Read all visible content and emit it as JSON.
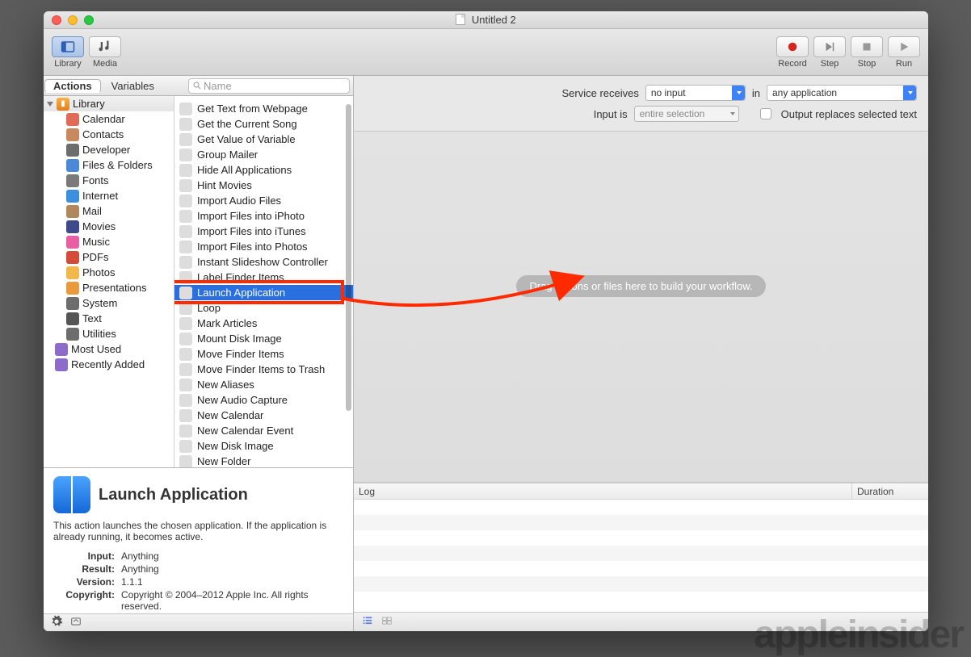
{
  "window": {
    "title": "Untitled 2"
  },
  "toolbar": {
    "library": "Library",
    "media": "Media",
    "record": "Record",
    "step": "Step",
    "stop": "Stop",
    "run": "Run"
  },
  "tabs": {
    "actions": "Actions",
    "variables": "Variables"
  },
  "search": {
    "placeholder": "Name"
  },
  "library_tree": {
    "root": "Library",
    "children": [
      "Calendar",
      "Contacts",
      "Developer",
      "Files & Folders",
      "Fonts",
      "Internet",
      "Mail",
      "Movies",
      "Music",
      "PDFs",
      "Photos",
      "Presentations",
      "System",
      "Text",
      "Utilities"
    ],
    "extra": [
      "Most Used",
      "Recently Added"
    ]
  },
  "actions": [
    "Get Text from Webpage",
    "Get the Current Song",
    "Get Value of Variable",
    "Group Mailer",
    "Hide All Applications",
    "Hint Movies",
    "Import Audio Files",
    "Import Files into iPhoto",
    "Import Files into iTunes",
    "Import Files into Photos",
    "Instant Slideshow Controller",
    "Label Finder Items",
    "Launch Application",
    "Loop",
    "Mark Articles",
    "Mount Disk Image",
    "Move Finder Items",
    "Move Finder Items to Trash",
    "New Aliases",
    "New Audio Capture",
    "New Calendar",
    "New Calendar Event",
    "New Disk Image",
    "New Folder"
  ],
  "selected_action_index": 12,
  "info": {
    "title": "Launch Application",
    "desc": "This action launches the chosen application. If the application is already running, it becomes active.",
    "rows": {
      "input_k": "Input:",
      "input_v": "Anything",
      "result_k": "Result:",
      "result_v": "Anything",
      "version_k": "Version:",
      "version_v": "1.1.1",
      "copyright_k": "Copyright:",
      "copyright_v": "Copyright © 2004–2012 Apple Inc.  All rights reserved."
    }
  },
  "config": {
    "service_receives_label": "Service receives",
    "service_receives_value": "no input",
    "in_label": "in",
    "in_value": "any application",
    "input_is_label": "Input is",
    "input_is_value": "entire selection",
    "output_replaces_label": "Output replaces selected text"
  },
  "canvas": {
    "placeholder": "Drag actions or files here to build your workflow."
  },
  "log": {
    "col1": "Log",
    "col2": "Duration"
  },
  "watermark": "appleinsider"
}
